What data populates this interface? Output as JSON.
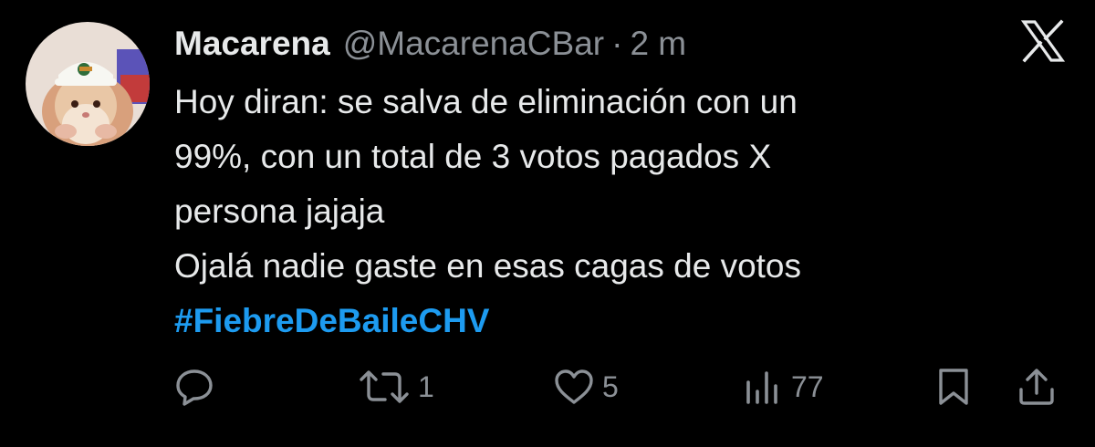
{
  "tweet": {
    "author_name": "Macarena",
    "author_handle": "@MacarenaCBar",
    "separator": "·",
    "timestamp": "2 m",
    "lines": [
      "Hoy diran: se salva de eliminación con un",
      "99%, con un total de 3 votos pagados X",
      "persona jajaja",
      "Ojalá nadie gaste en esas cagas de votos"
    ],
    "hashtag": "#FiebreDeBaileCHV"
  },
  "actions": {
    "reply_icon": "speech-bubble-icon",
    "retweet_icon": "retweet-icon",
    "retweet_count": "1",
    "like_icon": "heart-icon",
    "like_count": "5",
    "views_icon": "bar-chart-icon",
    "views_count": "77",
    "bookmark_icon": "bookmark-icon",
    "share_icon": "share-icon"
  },
  "brand": {
    "logo": "x-logo-icon"
  },
  "colors": {
    "background": "#000000",
    "text": "#e7e9ea",
    "secondary": "#8b9096",
    "link": "#1d9bf0"
  }
}
